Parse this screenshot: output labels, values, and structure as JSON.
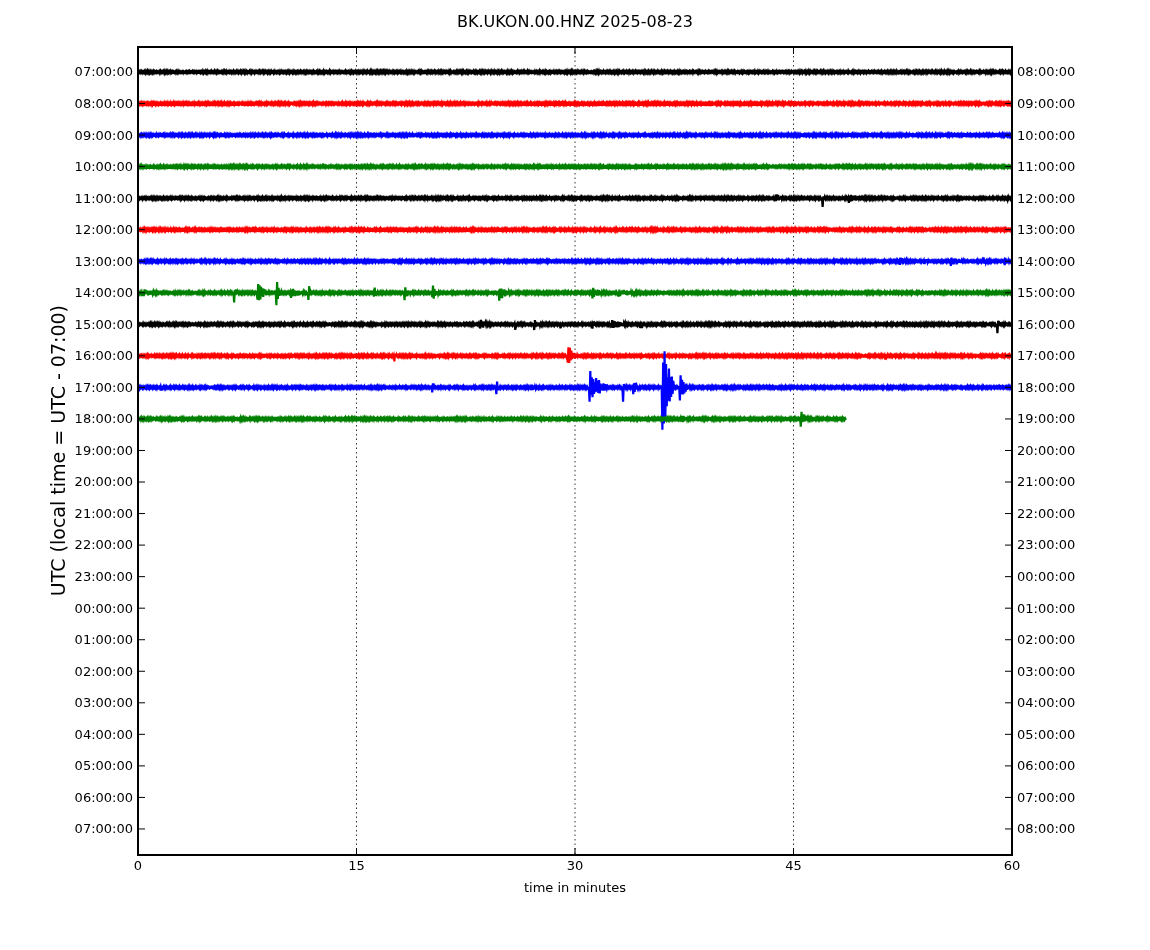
{
  "title": "BK.UKON.00.HNZ 2025-08-23",
  "y_axis_label": "UTC (local time = UTC - 07:00)",
  "x_axis_label": "time in minutes",
  "x_ticks": [
    "0",
    "15",
    "30",
    "45",
    "60"
  ],
  "left_labels": [
    "07:00:00",
    "08:00:00",
    "09:00:00",
    "10:00:00",
    "11:00:00",
    "12:00:00",
    "13:00:00",
    "14:00:00",
    "15:00:00",
    "16:00:00",
    "17:00:00",
    "18:00:00",
    "19:00:00",
    "20:00:00",
    "21:00:00",
    "22:00:00",
    "23:00:00",
    "00:00:00",
    "01:00:00",
    "02:00:00",
    "03:00:00",
    "04:00:00",
    "05:00:00",
    "06:00:00",
    "07:00:00"
  ],
  "right_labels": [
    "08:00:00",
    "09:00:00",
    "10:00:00",
    "11:00:00",
    "12:00:00",
    "13:00:00",
    "14:00:00",
    "15:00:00",
    "16:00:00",
    "17:00:00",
    "18:00:00",
    "19:00:00",
    "20:00:00",
    "21:00:00",
    "22:00:00",
    "23:00:00",
    "00:00:00",
    "01:00:00",
    "02:00:00",
    "03:00:00",
    "04:00:00",
    "05:00:00",
    "06:00:00",
    "07:00:00",
    "08:00:00"
  ],
  "traces": [
    {
      "color": "#000000",
      "level": 1
    },
    {
      "color": "#ff0000",
      "level": 1
    },
    {
      "color": "#0000ff",
      "level": 1
    },
    {
      "color": "#008000",
      "level": 1
    },
    {
      "color": "#000000",
      "level": 1
    },
    {
      "color": "#ff0000",
      "level": 1
    },
    {
      "color": "#0000ff",
      "level": 1
    },
    {
      "color": "#008000",
      "level": 1
    },
    {
      "color": "#000000",
      "level": 1
    },
    {
      "color": "#ff0000",
      "level": 1
    },
    {
      "color": "#0000ff",
      "level": 1
    },
    {
      "color": "#008000",
      "level": 0.81
    }
  ]
}
